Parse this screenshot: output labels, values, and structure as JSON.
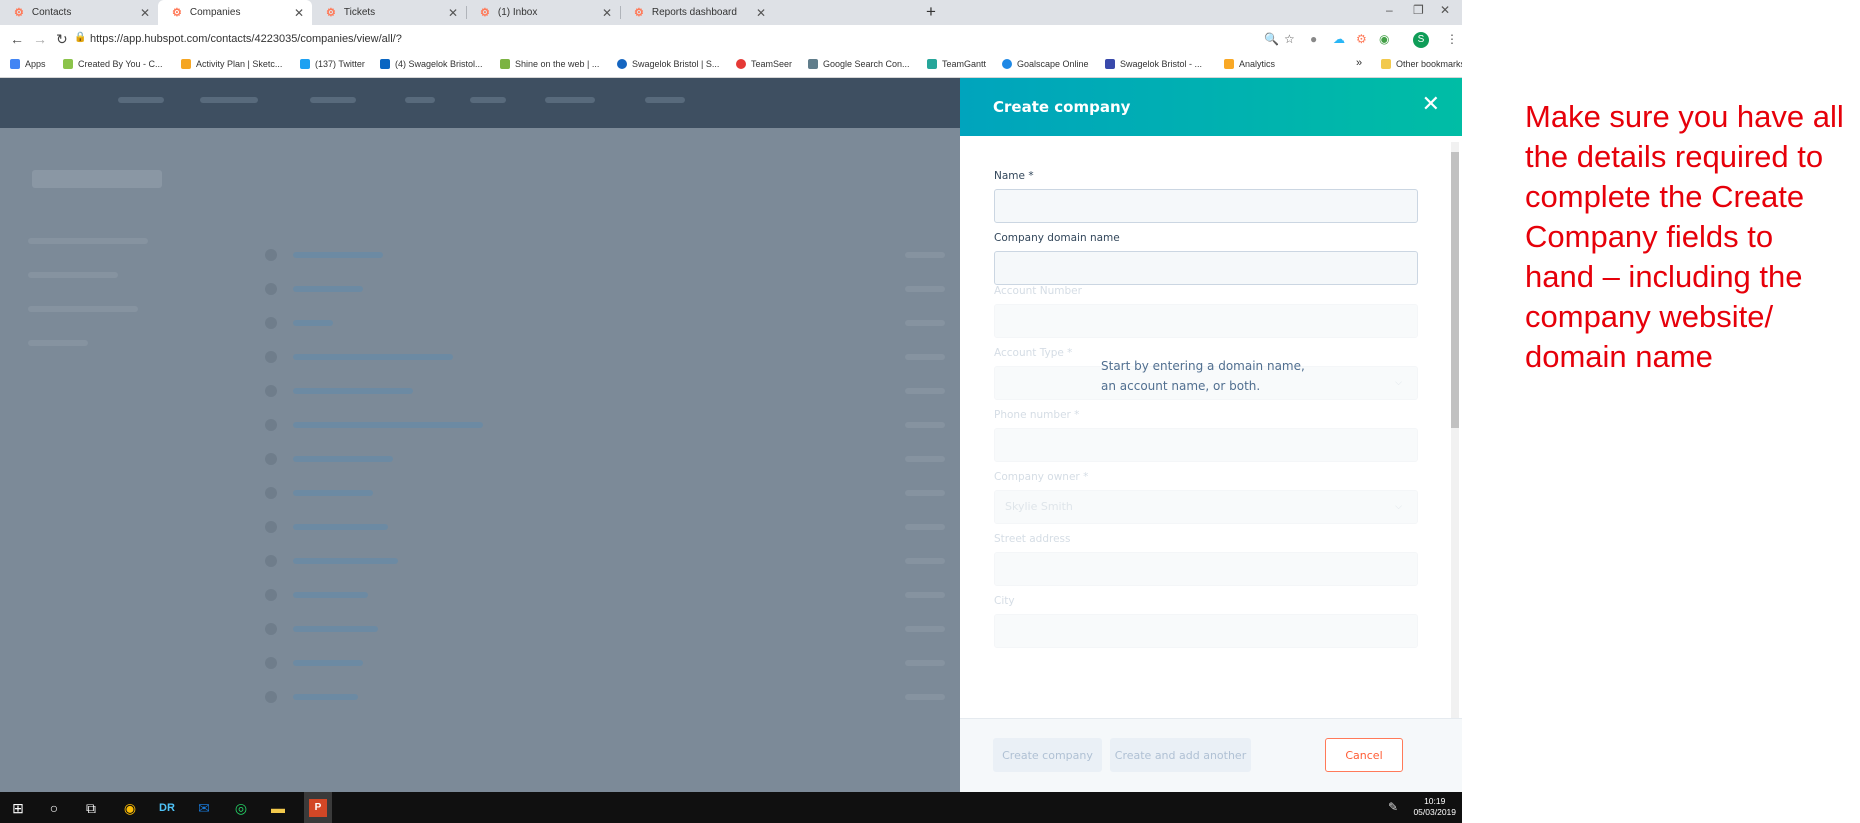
{
  "browser": {
    "tabs": [
      {
        "label": "Contacts",
        "active": false
      },
      {
        "label": "Companies",
        "active": true
      },
      {
        "label": "Tickets",
        "active": false
      },
      {
        "label": "(1) Inbox",
        "active": false
      },
      {
        "label": "Reports dashboard",
        "active": false
      }
    ],
    "url": "https://app.hubspot.com/contacts/4223035/companies/view/all/?",
    "bookmarks": [
      {
        "label": "Apps",
        "color": "#4285f4"
      },
      {
        "label": "Created By You - C...",
        "color": "#8bc34a"
      },
      {
        "label": "Activity Plan | Sketc...",
        "color": "#f5a623"
      },
      {
        "label": "(137) Twitter",
        "color": "#1da1f2"
      },
      {
        "label": "(4) Swagelok Bristol...",
        "color": "#0a66c2"
      },
      {
        "label": "Shine on the web | ...",
        "color": "#7cb342"
      },
      {
        "label": "Swagelok Bristol | S...",
        "color": "#1565c0"
      },
      {
        "label": "TeamSeer",
        "color": "#e53935"
      },
      {
        "label": "Google Search Con...",
        "color": "#607d8b"
      },
      {
        "label": "TeamGantt",
        "color": "#26a69a"
      },
      {
        "label": "Goalscape Online",
        "color": "#1e88e5"
      },
      {
        "label": "Swagelok Bristol - ...",
        "color": "#3949ab"
      },
      {
        "label": "Analytics",
        "color": "#f9a825"
      }
    ],
    "bookmarks_overflow": "»",
    "other_bookmarks": "Other bookmarks",
    "profile_initial": "S"
  },
  "drawer": {
    "title": "Create company",
    "fields": [
      {
        "label": "Name *",
        "value": ""
      },
      {
        "label": "Company domain name",
        "value": ""
      },
      {
        "label": "Account Number",
        "value": ""
      },
      {
        "label": "Account Type *",
        "value": ""
      },
      {
        "label": "Phone number *",
        "value": ""
      },
      {
        "label": "Company owner *",
        "value": "Skylie Smith"
      },
      {
        "label": "Street address",
        "value": ""
      },
      {
        "label": "City",
        "value": ""
      }
    ],
    "hint_line1": "Start by entering a domain name,",
    "hint_line2": "an account name, or both.",
    "buttons": {
      "create": "Create company",
      "create_another": "Create and add another",
      "cancel": "Cancel"
    }
  },
  "taskbar": {
    "time": "10:19",
    "date": "05/03/2019"
  },
  "annotation": "Make sure you have all the details required to complete the Create Company fields to hand – including the company website/ domain name",
  "colors": {
    "accent_start": "#00a4bd",
    "accent_end": "#00bda5",
    "cancel": "#ff5c35",
    "annotation": "#e6000a"
  }
}
